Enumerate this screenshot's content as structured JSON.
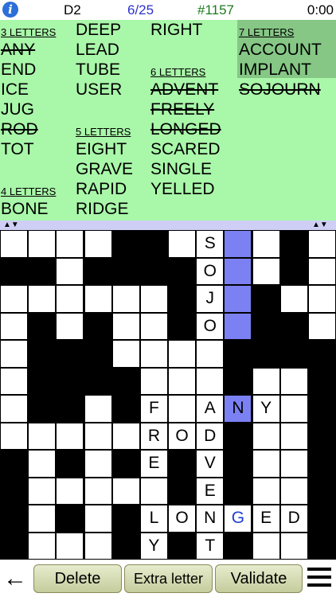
{
  "status": {
    "info_glyph": "i",
    "level": "D2",
    "progress": "6/25",
    "puzzle_number": "#1157",
    "timer": "0:00"
  },
  "words": {
    "col1": [
      {
        "text": "3 LETTERS",
        "kind": "hdr"
      },
      {
        "text": "ANY",
        "kind": "done"
      },
      {
        "text": "END",
        "kind": "word"
      },
      {
        "text": "ICE",
        "kind": "word"
      },
      {
        "text": "JUG",
        "kind": "word"
      },
      {
        "text": "ROD",
        "kind": "done"
      },
      {
        "text": "TOT",
        "kind": "word"
      },
      {
        "text": "",
        "kind": "gap"
      },
      {
        "text": "4 LETTERS",
        "kind": "hdr"
      },
      {
        "text": "BONE",
        "kind": "word"
      }
    ],
    "col2": [
      {
        "text": "DEEP",
        "kind": "word"
      },
      {
        "text": "LEAD",
        "kind": "word"
      },
      {
        "text": "TUBE",
        "kind": "word"
      },
      {
        "text": "USER",
        "kind": "word"
      },
      {
        "text": "",
        "kind": "gap"
      },
      {
        "text": "5 LETTERS",
        "kind": "hdr"
      },
      {
        "text": "EIGHT",
        "kind": "word"
      },
      {
        "text": "GRAVE",
        "kind": "word"
      },
      {
        "text": "RAPID",
        "kind": "word"
      },
      {
        "text": "RIDGE",
        "kind": "word"
      }
    ],
    "col3": [
      {
        "text": "RIGHT",
        "kind": "word"
      },
      {
        "text": "",
        "kind": "gap"
      },
      {
        "text": "6 LETTERS",
        "kind": "hdr"
      },
      {
        "text": "ADVENT",
        "kind": "done"
      },
      {
        "text": "FREELY",
        "kind": "done"
      },
      {
        "text": "LONGED",
        "kind": "done"
      },
      {
        "text": "SCARED",
        "kind": "word"
      },
      {
        "text": "SINGLE",
        "kind": "word"
      },
      {
        "text": "YELLED",
        "kind": "word"
      }
    ],
    "col4": [
      {
        "text": "7 LETTERS",
        "kind": "hdr"
      },
      {
        "text": "ACCOUNT",
        "kind": "word"
      },
      {
        "text": "IMPLANT",
        "kind": "word"
      },
      {
        "text": "SOJOURN",
        "kind": "done"
      }
    ]
  },
  "grid": {
    "rows": [
      "....##.S..#.",
      "##.####O..#.",
      "......#J.#..",
      ".#.#..#O.##.",
      ".###....####",
      ".####...#..#",
      ".##.#F.ANY.#",
      ".....ROD#..#",
      "#.#.#E#V#..#",
      "#.....#E#..#",
      "#.#.#LONGED#",
      "#...#Y#T#..#"
    ],
    "selected": [
      [
        0,
        8
      ],
      [
        1,
        8
      ],
      [
        2,
        8
      ],
      [
        3,
        8
      ],
      [
        4,
        8
      ],
      [
        5,
        8
      ],
      [
        6,
        8
      ]
    ],
    "highlight_letters": [
      [
        10,
        8
      ]
    ],
    "highlight_color": "#1d3fd6",
    "selected_color": "#7b81f2"
  },
  "bottom": {
    "back_glyph": "←",
    "delete_label": "Delete",
    "extra_label": "Extra letter",
    "validate_label": "Validate"
  }
}
